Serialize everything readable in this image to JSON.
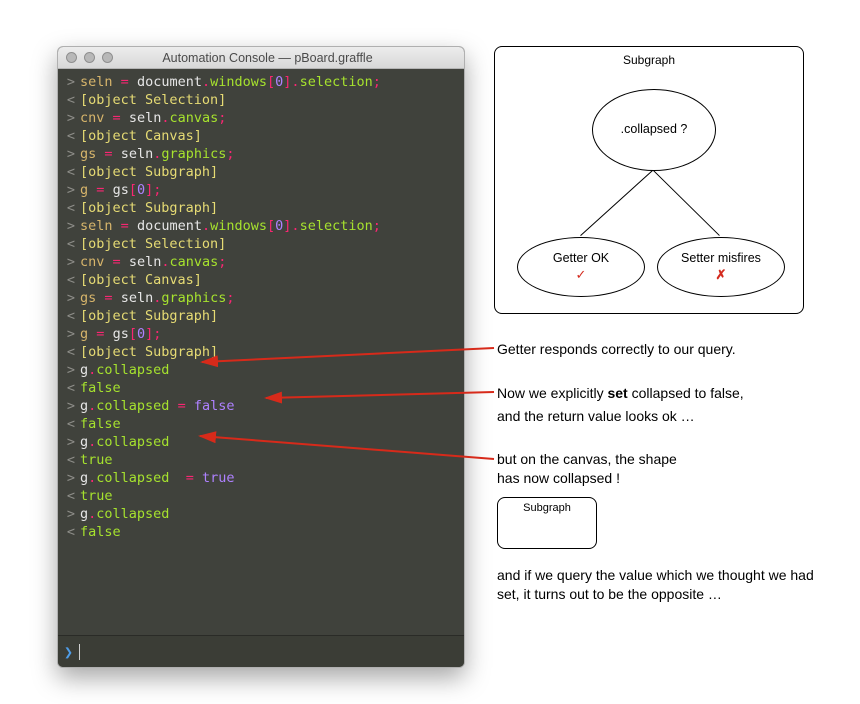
{
  "window": {
    "title": "Automation Console — pBoard.graffle"
  },
  "console": {
    "lines": [
      {
        "dir": ">",
        "html": "<span class='c-var'>seln</span> <span class='c-op'>=</span> <span class='c-id'>document</span><span class='c-op'>.</span><span class='c-attr'>windows</span><span class='c-op'>[</span><span class='c-num'>0</span><span class='c-op'>].</span><span class='c-attr'>selection</span><span class='c-op'>;</span>"
      },
      {
        "dir": "<",
        "html": "<span class='c-out'>[object Selection]</span>"
      },
      {
        "dir": ">",
        "html": "<span class='c-var'>cnv</span> <span class='c-op'>=</span> <span class='c-id'>seln</span><span class='c-op'>.</span><span class='c-attr'>canvas</span><span class='c-op'>;</span>"
      },
      {
        "dir": "<",
        "html": "<span class='c-out'>[object Canvas]</span>"
      },
      {
        "dir": ">",
        "html": "<span class='c-var'>gs</span> <span class='c-op'>=</span> <span class='c-id'>seln</span><span class='c-op'>.</span><span class='c-attr'>graphics</span><span class='c-op'>;</span>"
      },
      {
        "dir": "<",
        "html": "<span class='c-out'>[object Subgraph]</span>"
      },
      {
        "dir": ">",
        "html": "<span class='c-var'>g</span> <span class='c-op'>=</span> <span class='c-id'>gs</span><span class='c-op'>[</span><span class='c-num'>0</span><span class='c-op'>];</span>"
      },
      {
        "dir": "<",
        "html": "<span class='c-out'>[object Subgraph]</span>"
      },
      {
        "dir": ">",
        "html": "<span class='c-var'>seln</span> <span class='c-op'>=</span> <span class='c-id'>document</span><span class='c-op'>.</span><span class='c-attr'>windows</span><span class='c-op'>[</span><span class='c-num'>0</span><span class='c-op'>].</span><span class='c-attr'>selection</span><span class='c-op'>;</span>"
      },
      {
        "dir": "<",
        "html": "<span class='c-out'>[object Selection]</span>"
      },
      {
        "dir": ">",
        "html": "<span class='c-var'>cnv</span> <span class='c-op'>=</span> <span class='c-id'>seln</span><span class='c-op'>.</span><span class='c-attr'>canvas</span><span class='c-op'>;</span>"
      },
      {
        "dir": "<",
        "html": "<span class='c-out'>[object Canvas]</span>"
      },
      {
        "dir": ">",
        "html": "<span class='c-var'>gs</span> <span class='c-op'>=</span> <span class='c-id'>seln</span><span class='c-op'>.</span><span class='c-attr'>graphics</span><span class='c-op'>;</span>"
      },
      {
        "dir": "<",
        "html": "<span class='c-out'>[object Subgraph]</span>"
      },
      {
        "dir": ">",
        "html": "<span class='c-var'>g</span> <span class='c-op'>=</span> <span class='c-id'>gs</span><span class='c-op'>[</span><span class='c-num'>0</span><span class='c-op'>];</span>"
      },
      {
        "dir": "<",
        "html": "<span class='c-out'>[object Subgraph]</span>"
      },
      {
        "dir": ">",
        "html": "<span class='c-id'>g</span><span class='c-op'>.</span><span class='c-attr'>collapsed</span>"
      },
      {
        "dir": "<",
        "html": "<span class='c-false'>false</span>"
      },
      {
        "dir": ">",
        "html": "<span class='c-id'>g</span><span class='c-op'>.</span><span class='c-attr'>collapsed</span> <span class='c-op'>=</span> <span class='c-bool'>false</span>"
      },
      {
        "dir": "<",
        "html": "<span class='c-false'>false</span>"
      },
      {
        "dir": ">",
        "html": "<span class='c-id'>g</span><span class='c-op'>.</span><span class='c-attr'>collapsed</span>"
      },
      {
        "dir": "<",
        "html": "<span class='c-true'>true</span>"
      },
      {
        "dir": ">",
        "html": "<span class='c-id'>g</span><span class='c-op'>.</span><span class='c-attr'>collapsed</span>  <span class='c-op'>=</span> <span class='c-bool'>true</span>"
      },
      {
        "dir": "<",
        "html": "<span class='c-true'>true</span>"
      },
      {
        "dir": ">",
        "html": "<span class='c-id'>g</span><span class='c-op'>.</span><span class='c-attr'>collapsed</span>"
      },
      {
        "dir": "<",
        "html": "<span class='c-false'>false</span>"
      }
    ],
    "input_value": ""
  },
  "diagram": {
    "title": "Subgraph",
    "top_label": ".collapsed ?",
    "left_label": "Getter OK",
    "left_mark": "✓",
    "right_label": "Setter misfires",
    "right_mark": "✗"
  },
  "annotations": {
    "a1": "Getter responds correctly to our query.",
    "a2_pre": "Now we explicitly ",
    "a2_bold": "set",
    "a2_post": " collapsed to false,",
    "a3": "and the return value looks ok …",
    "a4": "but on the canvas, the shape\nhas now collapsed !",
    "mini_title": "Subgraph",
    "a5": "and if we query the value which we thought we had set, it turns out to be the opposite …"
  }
}
